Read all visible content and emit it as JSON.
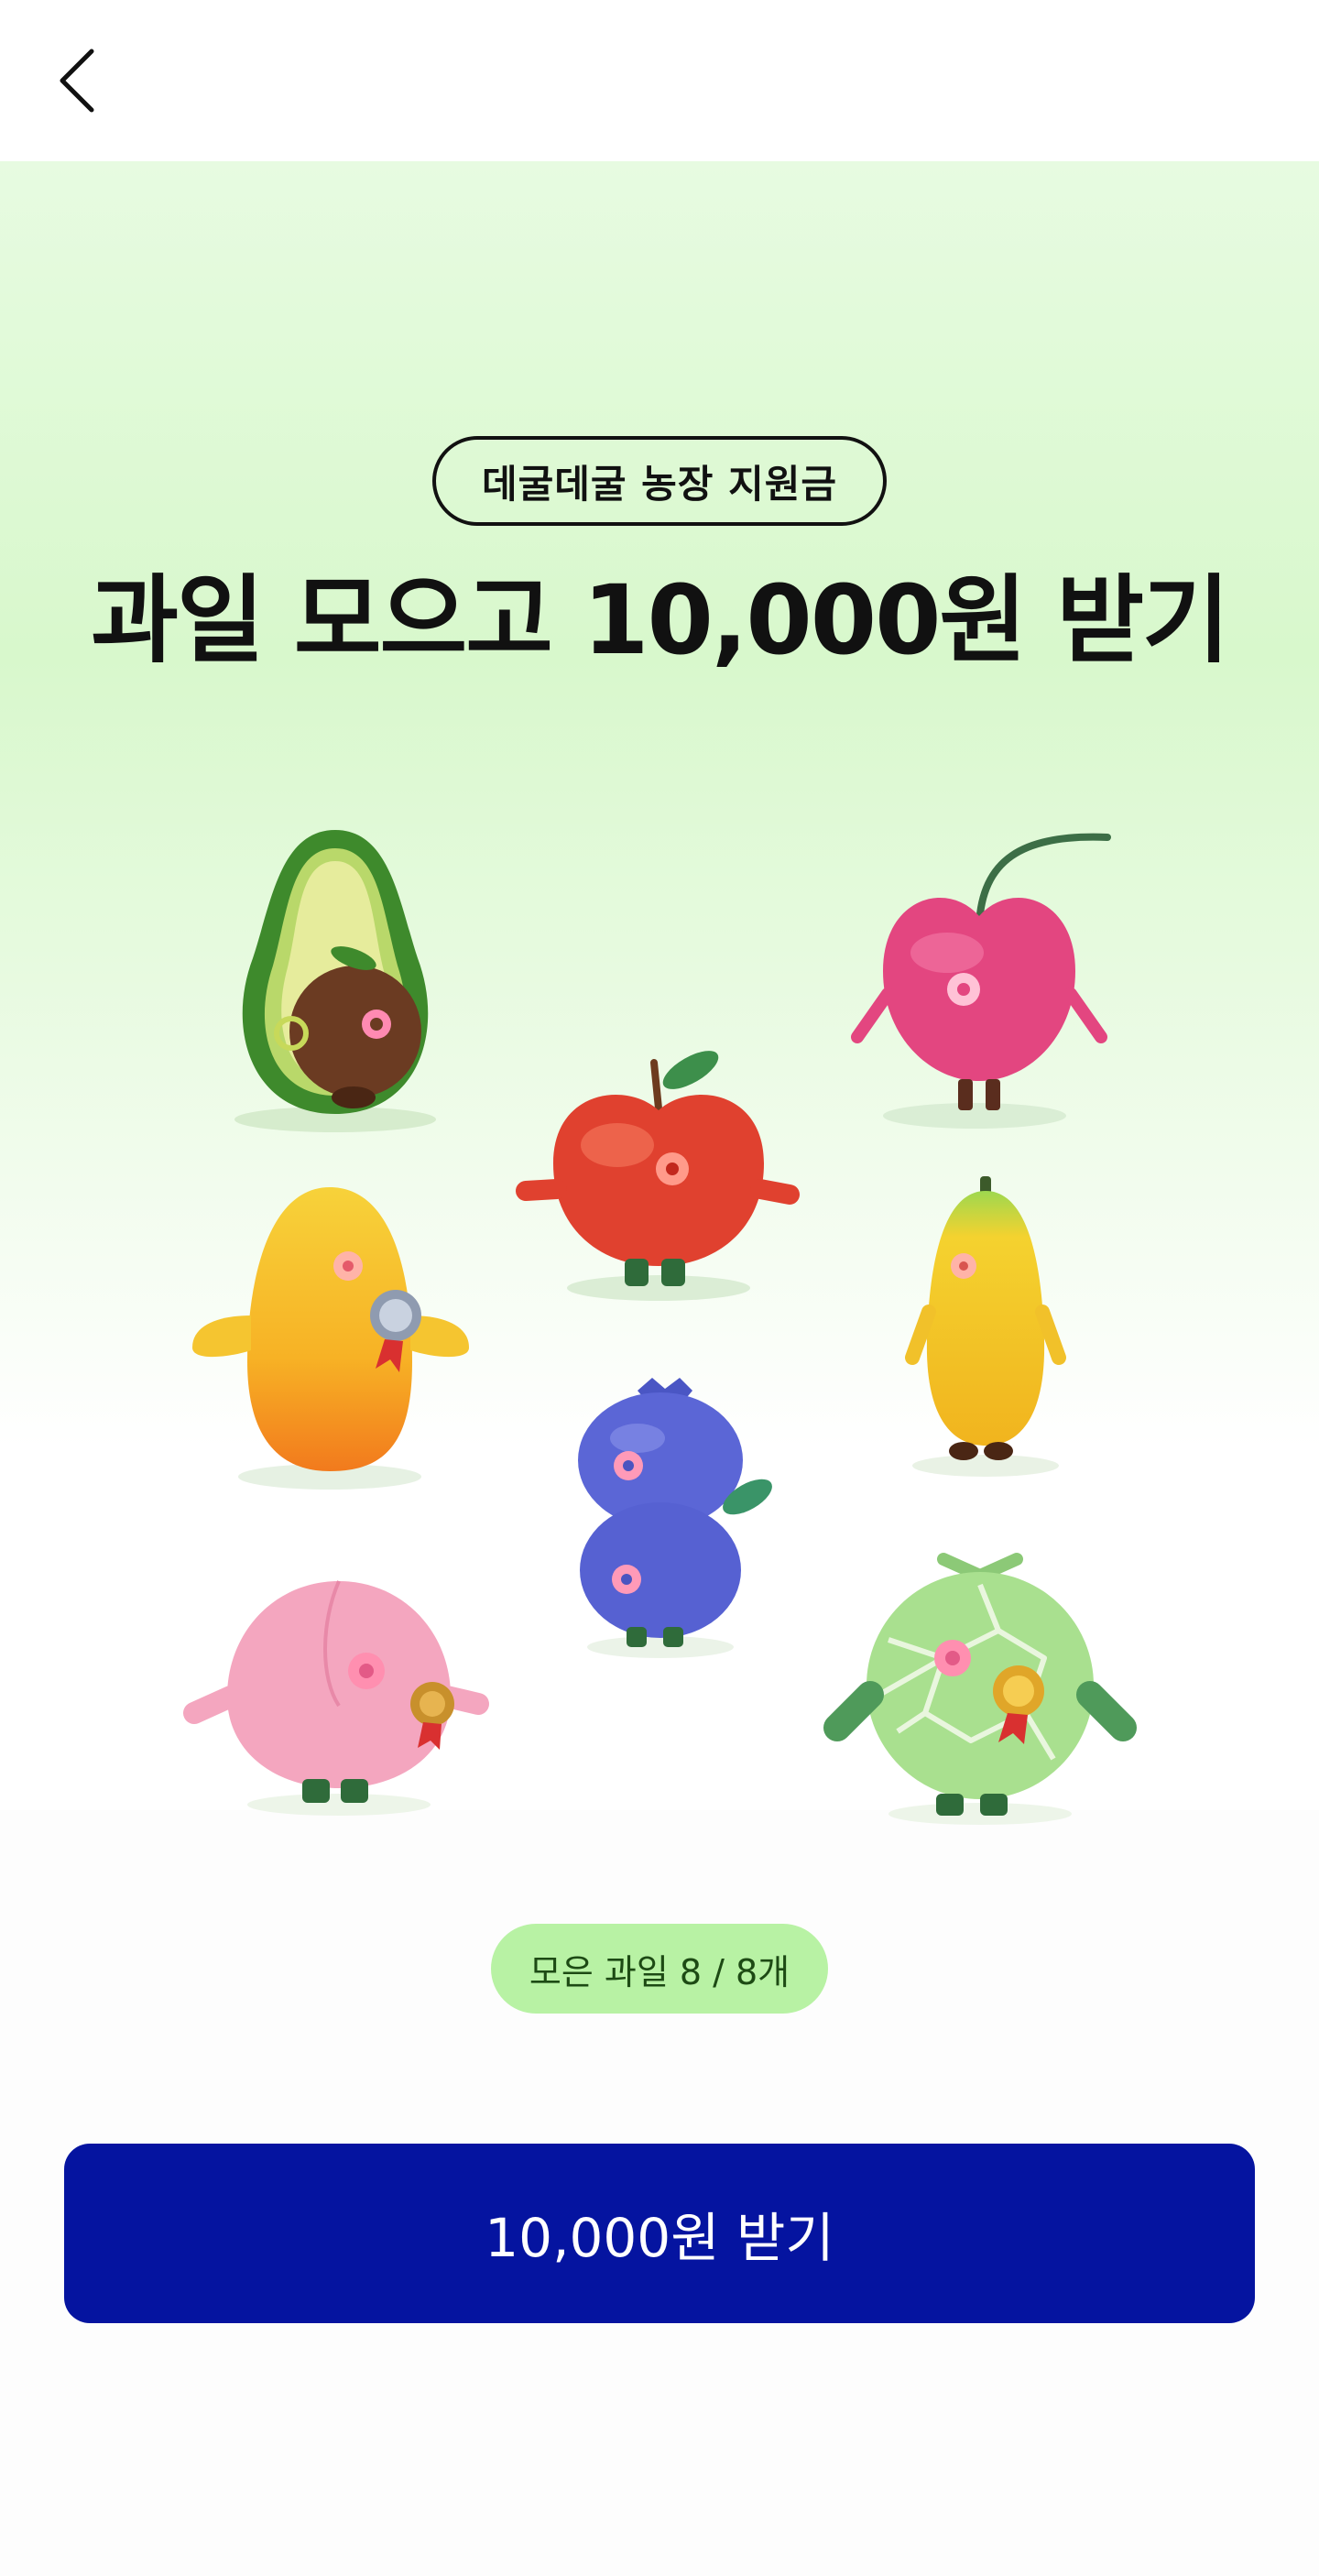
{
  "nav": {
    "back_icon": "chevron-left-icon"
  },
  "hero": {
    "badge": "데굴데굴 농장 지원금",
    "title": "과일 모으고 10,000원 받기"
  },
  "fruits": [
    {
      "name": "avocado",
      "color": "#4f9a3a"
    },
    {
      "name": "cherry",
      "color": "#e8467f"
    },
    {
      "name": "apple",
      "color": "#e2423a"
    },
    {
      "name": "mango",
      "color": "#f5b021"
    },
    {
      "name": "papaya",
      "color": "#f2c72c"
    },
    {
      "name": "blueberry",
      "color": "#5d66d8"
    },
    {
      "name": "peach",
      "color": "#f4a7bf"
    },
    {
      "name": "melon",
      "color": "#9ed98a"
    }
  ],
  "progress": {
    "label": "모은 과일 8 / 8개",
    "collected": 8,
    "total": 8
  },
  "cta": {
    "label": "10,000원 받기",
    "color": "#0514a0"
  },
  "accent_colors": {
    "hero_green": "#d8f8cc",
    "pill_green": "#b8f2a4"
  }
}
